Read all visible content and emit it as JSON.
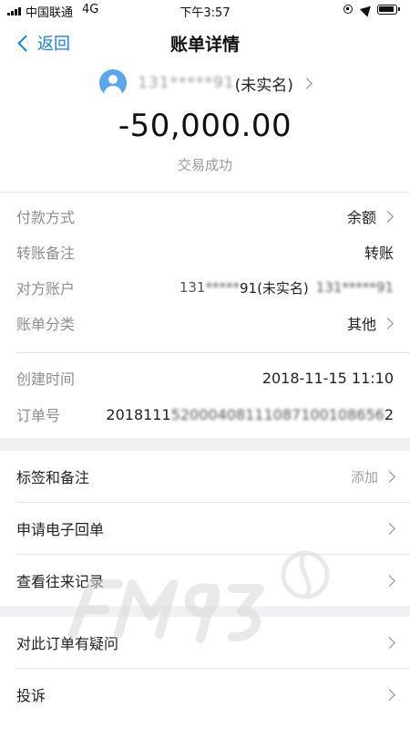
{
  "status_bar": {
    "carrier": "中国联通",
    "network": "4G",
    "time": "下午3:57"
  },
  "nav": {
    "back_label": "返回",
    "title": "账单详情"
  },
  "header": {
    "payee_masked": "131*****91",
    "payee_suffix": "(未实名)",
    "amount": "-50,000.00",
    "status": "交易成功"
  },
  "details": [
    {
      "label": "付款方式",
      "value": "余额",
      "chevron": true
    },
    {
      "label": "转账备注",
      "value": "转账",
      "chevron": false
    },
    {
      "label": "对方账户",
      "value_prefix": "131",
      "value_mid": "*****",
      "value_suffix": "91(未实名)",
      "value_tail": "131*****91",
      "chevron": false
    },
    {
      "label": "账单分类",
      "value": "其他",
      "chevron": true
    }
  ],
  "meta": [
    {
      "label": "创建时间",
      "value": "2018-11-15 11:10"
    },
    {
      "label": "订单号",
      "value_visible": "2018111",
      "value_masked": "52000408111087100108656",
      "value_end": "2"
    }
  ],
  "actions_group1": [
    {
      "label": "标签和备注",
      "right": "添加"
    },
    {
      "label": "申请电子回单",
      "right": ""
    },
    {
      "label": "查看往来记录",
      "right": ""
    }
  ],
  "actions_group2": [
    {
      "label": "对此订单有疑问",
      "right": ""
    },
    {
      "label": "投诉",
      "right": ""
    }
  ],
  "colors": {
    "accent": "#1a82e0",
    "avatar": "#5aa6ec",
    "muted": "#8e8e8e",
    "background": "#f1f1f3"
  }
}
